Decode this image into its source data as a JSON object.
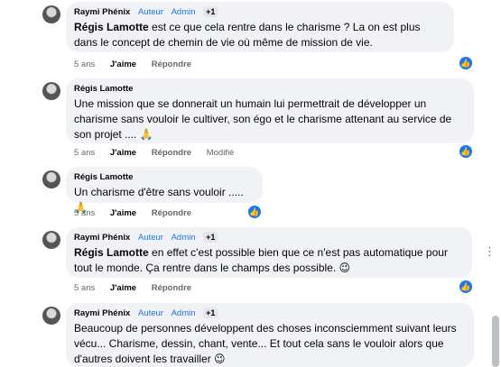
{
  "comments": [
    {
      "author": "Raymi Phénix",
      "badge1": "Auteur",
      "badge2": "Admin",
      "extra": "+1",
      "mention": "Régis Lamotte",
      "text": " est ce que cela rentre dans le charisme ? La on est plus dans le concept de chemin de vie où même de mission de vie.",
      "time": "5 ans",
      "like": "J'aime",
      "reply": "Répondre"
    },
    {
      "author": "Régis Lamotte",
      "text": "Une mission que se donnerait un humain lui permettrait de développer un charisme sans vouloir le cultiver, son égo et le charisme attenant au service de son projet .... 🙏",
      "time": "5 ans",
      "like": "J'aime",
      "reply": "Répondre",
      "modified": "Modifié"
    },
    {
      "author": "Régis Lamotte",
      "text": "Un charisme d'être sans vouloir ..... 🙏",
      "time": "5 ans",
      "like": "J'aime",
      "reply": "Répondre"
    },
    {
      "author": "Raymi Phénix",
      "badge1": "Auteur",
      "badge2": "Admin",
      "extra": "+1",
      "mention": "Régis Lamotte",
      "text": " en effet c'est possible bien que ce n'est pas automatique pour tout le monde. Ça rentre dans le champs des possible. 😉",
      "time": "5 ans",
      "like": "J'aime",
      "reply": "Répondre"
    },
    {
      "author": "Raymi Phénix",
      "badge1": "Auteur",
      "badge2": "Admin",
      "extra": "+1",
      "text": "Beaucoup de personnes développent des choses inconsciemment suivant leurs vécu... Charisme, dessin, chant, vente... Et tout cela sans le vouloir alors que d'autres doivent les travailler 😉"
    }
  ],
  "icons": {
    "like": "thumbs-up-icon",
    "more": "more-options-icon"
  }
}
